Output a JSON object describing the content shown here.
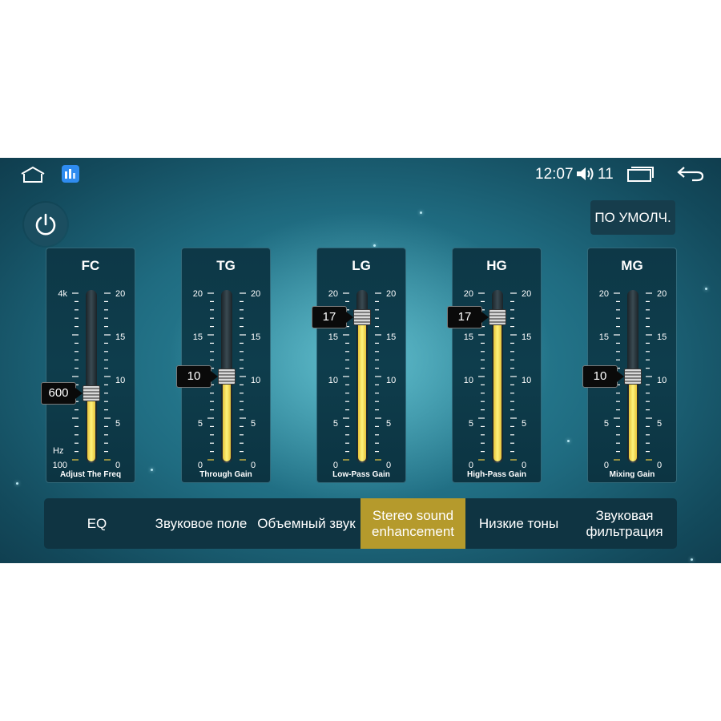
{
  "status_bar": {
    "time": "12:07",
    "volume": "11",
    "icons": [
      "home-icon",
      "app-icon",
      "volume-icon",
      "recent-apps-icon",
      "back-icon"
    ]
  },
  "toolbar": {
    "power_icon": "power-icon",
    "default_label": "ПО УМОЛЧ."
  },
  "sliders": [
    {
      "title": "FC",
      "caption": "Adjust The Freq",
      "value": "600",
      "level": 0.4,
      "left_ticks": {
        "top": "4k",
        "bottom": "100"
      },
      "unit": "Hz",
      "right_ticks": [
        "20",
        "15",
        "10",
        "5",
        "0"
      ]
    },
    {
      "title": "TG",
      "caption": "Through Gain",
      "value": "10",
      "level": 0.5,
      "left_ticks": [
        "20",
        "15",
        "10",
        "5",
        "0"
      ],
      "right_ticks": [
        "20",
        "15",
        "10",
        "5",
        "0"
      ]
    },
    {
      "title": "LG",
      "caption": "Low-Pass Gain",
      "value": "17",
      "level": 0.85,
      "left_ticks": [
        "20",
        "15",
        "10",
        "5",
        "0"
      ],
      "right_ticks": [
        "20",
        "15",
        "10",
        "5",
        "0"
      ]
    },
    {
      "title": "HG",
      "caption": "High-Pass Gain",
      "value": "17",
      "level": 0.85,
      "left_ticks": [
        "20",
        "15",
        "10",
        "5",
        "0"
      ],
      "right_ticks": [
        "20",
        "15",
        "10",
        "5",
        "0"
      ]
    },
    {
      "title": "MG",
      "caption": "Mixing Gain",
      "value": "10",
      "level": 0.5,
      "left_ticks": [
        "20",
        "15",
        "10",
        "5",
        "0"
      ],
      "right_ticks": [
        "20",
        "15",
        "10",
        "5",
        "0"
      ]
    }
  ],
  "tabs": [
    {
      "label": "EQ",
      "active": false
    },
    {
      "label": "Звуковое поле",
      "active": false
    },
    {
      "label": "Объемный звук",
      "active": false
    },
    {
      "label": "Stereo sound enhancement",
      "active": true
    },
    {
      "label": "Низкие тоны",
      "active": false
    },
    {
      "label": "Звуковая фильтрация",
      "active": false
    }
  ],
  "colors": {
    "fill": "#fff27a",
    "active_tab": "#b59a2c",
    "panel": "#0e3d4c",
    "background": "#1f6b80"
  }
}
